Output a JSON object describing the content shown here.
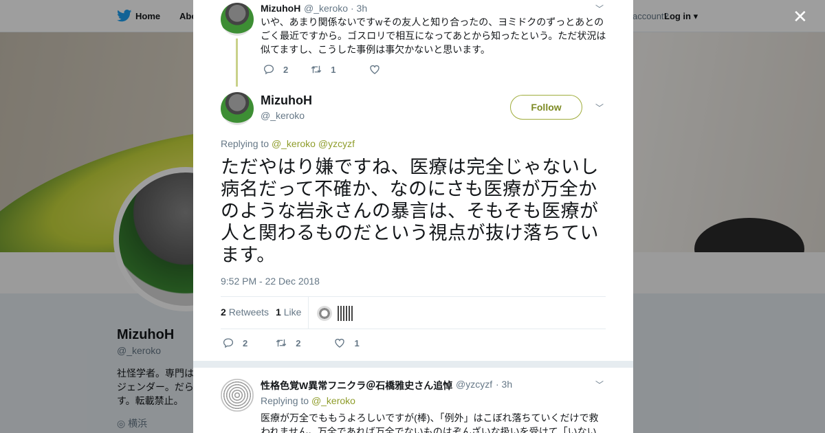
{
  "background": {
    "nav": {
      "home_label": "Home",
      "about_label": "Abo",
      "account_prompt": "account?",
      "login_label": "Log in"
    },
    "profile": {
      "name": "MizuhoH",
      "handle": "@_keroko",
      "bio": "社怪学者。専門は\nジェンダー。だら\nす。転載禁止。",
      "location": "横浜"
    }
  },
  "modal": {
    "close_icon": "close-icon",
    "parent_tweet": {
      "name": "MizuhoH",
      "handle": "@_keroko",
      "time": "· 3h",
      "text": "いや、あまり関係ないですwその友人と知り合ったの、ヨミドクのずっとあとのごく最近ですから。ゴスロリで相互になってあとから知ったという。ただ状況は似てますし、こうした事例は事欠かないと思います。",
      "replies": "2",
      "retweets": "1",
      "likes": ""
    },
    "focused_tweet": {
      "name": "MizuhoH",
      "handle": "@_keroko",
      "follow_label": "Follow",
      "replying_to_label": "Replying to",
      "replying_to_1": "@_keroko",
      "replying_to_2": "@yzcyzf",
      "text": "ただやはり嫌ですね、医療は完全じゃないし病名だって不確か、なのにさも医療が万全かのような岩永さんの暴言は、そもそも医療が人と関わるものだという視点が抜け落ちています。",
      "timestamp": "9:52 PM - 22 Dec 2018",
      "retweets_count": "2",
      "retweets_label": "Retweets",
      "likes_count": "1",
      "likes_label": "Like",
      "replies": "2",
      "retweets": "2",
      "likes": "1"
    },
    "reply_tweet": {
      "name": "性格色覚W異常フニクラ＠石橋雅史さん追悼",
      "handle": "@yzcyzf",
      "time": "· 3h",
      "replying_to_label": "Replying to",
      "replying_to": "@_keroko",
      "text": "医療が万全でももうよろしいですが(棒)、「例外」はこぼれ落ちていくだけで救われません。万全であれば万全でないものはぞんざいな扱いを受けて「いない"
    }
  },
  "colors": {
    "accent_olive": "#8e9c2a",
    "text": "#14171a",
    "muted": "#657786",
    "twitter_blue": "#1da1f2"
  }
}
